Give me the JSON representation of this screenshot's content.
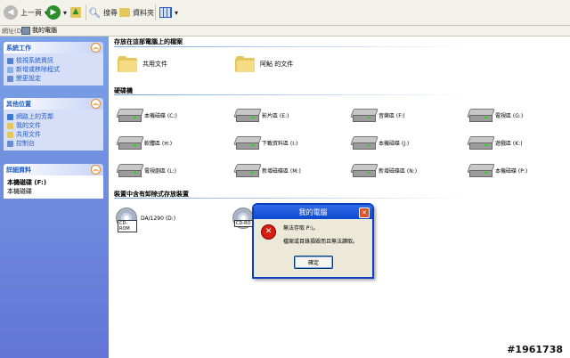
{
  "toolbar": {
    "back_label": "上一頁",
    "search_label": "搜尋",
    "folders_label": "資料夾"
  },
  "address": {
    "label": "網址(D)",
    "value": "我的電腦"
  },
  "task_pane": {
    "system": {
      "title": "系統工作",
      "items": [
        "檢視系統資訊",
        "新增或移除程式",
        "變更設定"
      ]
    },
    "other": {
      "title": "其他位置",
      "items": [
        "網路上的芳鄰",
        "我的文件",
        "共用文件",
        "控制台"
      ]
    },
    "details": {
      "title": "詳細資料",
      "name": "本機磁碟 (F:)",
      "type": "本機磁碟"
    }
  },
  "main": {
    "section_files": "存放在這部電腦上的檔案",
    "folders": [
      "共用文件",
      "阿鮎 的文件"
    ],
    "section_drives": "硬碟機",
    "drives": [
      "本機磁碟 (C:)",
      "影片區 (E:)",
      "音樂區 (F:)",
      "電視區 (G:)",
      "軟體區 (H:)",
      "下載資料區 (I:)",
      "本機磁碟 (J:)",
      "遊戲區 (K:)",
      "電視劇區 (L:)",
      "新增磁碟區 (M:)",
      "新增磁碟區 (N:)",
      "本機磁碟 (P:)"
    ],
    "section_removable": "裝置中含有卸除式存放裝置",
    "removable": [
      {
        "label": "DA/1290 (D:)",
        "badge": "CD-ROM"
      },
      {
        "label": "",
        "badge": "CD-RO"
      }
    ]
  },
  "dialog": {
    "title": "我的電腦",
    "message1": "無法存取 P:\\。",
    "message2": "檔案或目錄損毀而且無法讀取。",
    "ok_label": "確定"
  },
  "watermark": "#1961738"
}
